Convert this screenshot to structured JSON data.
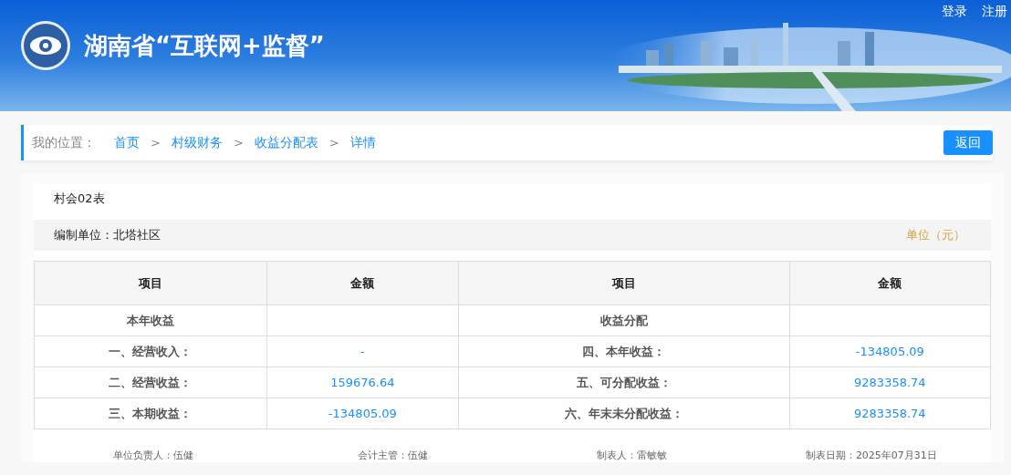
{
  "header": {
    "title": "湖南省“互联网+监督”",
    "links": [
      "登录",
      "注册"
    ]
  },
  "breadcrumb": {
    "label": "我的位置：",
    "items": [
      "首页",
      "村级财务",
      "收益分配表",
      "详情"
    ],
    "separator": ">",
    "back_button": "返回"
  },
  "report": {
    "form_code": "村会02表",
    "unit_label": "编制单位：北塔社区",
    "currency": "单位（元）",
    "columns": [
      "项目",
      "金额",
      "项目",
      "金额"
    ],
    "rows": [
      {
        "cells": [
          "本年收益",
          "",
          "收益分配",
          ""
        ]
      },
      {
        "cells": [
          "一、经营收入：",
          "-",
          "四、本年收益：",
          "-134805.09"
        ]
      },
      {
        "cells": [
          "二、经营收益：",
          "159676.64",
          "五、可分配收益：",
          "9283358.74"
        ]
      },
      {
        "cells": [
          "三、本期收益：",
          "-134805.09",
          "六、年末未分配收益：",
          "9283358.74"
        ]
      }
    ],
    "signatures": [
      "单位负责人：伍健",
      "会计主管：伍健",
      "制表人：雷敏敏",
      "制表日期：2025年07月31日"
    ]
  }
}
